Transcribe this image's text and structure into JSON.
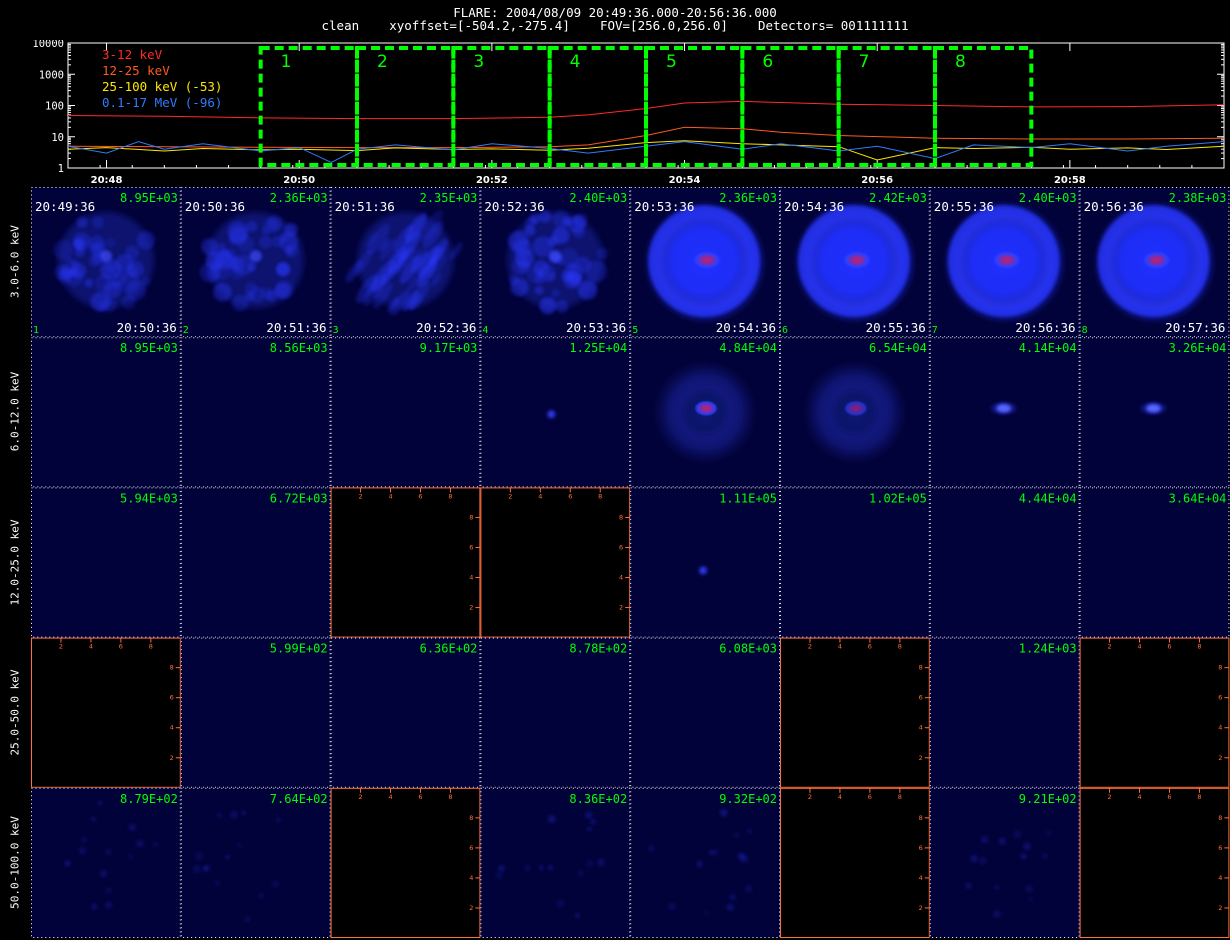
{
  "header": {
    "line1": "FLARE: 2004/08/09 20:49:36.000-20:56:36.000",
    "line2": "clean    xyoffset=[-504.2,-275.4]    FOV=[256.0,256.0]    Detectors= 001111111"
  },
  "colors": {
    "green": "#00ff00",
    "white": "#ffffff",
    "orange_axis": "#ff6f3c",
    "panel_bg": "#02023a"
  },
  "chart_data": [
    {
      "type": "line",
      "log_y": true,
      "ylim": [
        1,
        10000
      ],
      "yticks": [
        "10000",
        "1000",
        "100",
        "10",
        "1"
      ],
      "yticks_values": [
        10000,
        1000,
        100,
        10,
        1
      ],
      "xlim": [
        "20:47:36",
        "20:59:36"
      ],
      "xticks": [
        "20:48",
        "20:50",
        "20:52",
        "20:54",
        "20:56",
        "20:58"
      ],
      "legend": [
        {
          "label": "3-12 keV",
          "color": "#ff2a2a"
        },
        {
          "label": "12-25 keV",
          "color": "#ff5a1e"
        },
        {
          "label": "25-100 keV (-53)",
          "color": "#ffe600"
        },
        {
          "label": "0.1-17 MeV (-96)",
          "color": "#2f7bff"
        }
      ],
      "series": [
        {
          "name": "3-12 keV",
          "color": "#ff2a2a",
          "x": [
            "20:47:36",
            "20:48:36",
            "20:49:36",
            "20:50:36",
            "20:51:36",
            "20:52:36",
            "20:53:00",
            "20:53:36",
            "20:54:00",
            "20:54:36",
            "20:55:00",
            "20:55:36",
            "20:56:36",
            "20:57:36",
            "20:58:36",
            "20:59:36"
          ],
          "values": [
            48,
            45,
            40,
            38,
            38,
            42,
            50,
            80,
            120,
            135,
            125,
            110,
            100,
            90,
            92,
            105
          ]
        },
        {
          "name": "12-25 keV",
          "color": "#ff5a1e",
          "x": [
            "20:47:36",
            "20:48:36",
            "20:49:36",
            "20:50:36",
            "20:51:36",
            "20:52:36",
            "20:53:00",
            "20:53:36",
            "20:54:00",
            "20:54:36",
            "20:55:00",
            "20:55:36",
            "20:56:36",
            "20:57:36",
            "20:58:36",
            "20:59:36"
          ],
          "values": [
            5,
            4.8,
            4.6,
            4.5,
            4.5,
            4.8,
            5.5,
            11,
            20,
            18,
            14,
            11,
            9,
            8.5,
            8.5,
            9
          ]
        },
        {
          "name": "25-100 keV (-53)",
          "color": "#ffe600",
          "x": [
            "20:47:36",
            "20:48:00",
            "20:48:36",
            "20:49:00",
            "20:49:36",
            "20:50:00",
            "20:50:36",
            "20:51:00",
            "20:51:36",
            "20:52:00",
            "20:52:36",
            "20:53:00",
            "20:53:36",
            "20:54:00",
            "20:54:36",
            "20:55:00",
            "20:55:36",
            "20:56:00",
            "20:56:36",
            "20:57:00",
            "20:57:36",
            "20:58:00",
            "20:58:36",
            "20:59:00",
            "20:59:36"
          ],
          "values": [
            4,
            4.5,
            3.5,
            4.2,
            3.8,
            4.0,
            3.6,
            4.4,
            3.9,
            4.1,
            3.7,
            4.3,
            6.5,
            7.5,
            6,
            5.5,
            4.8,
            1.8,
            4.5,
            4.2,
            4.6,
            4.0,
            4.4,
            3.9,
            5
          ]
        },
        {
          "name": "0.1-17 MeV (-96)",
          "color": "#2f7bff",
          "x": [
            "20:47:36",
            "20:48:00",
            "20:48:20",
            "20:48:36",
            "20:49:00",
            "20:49:36",
            "20:50:00",
            "20:50:20",
            "20:50:36",
            "20:51:00",
            "20:51:36",
            "20:52:00",
            "20:52:36",
            "20:53:00",
            "20:53:36",
            "20:54:00",
            "20:54:36",
            "20:55:00",
            "20:55:36",
            "20:56:00",
            "20:56:36",
            "20:57:00",
            "20:57:36",
            "20:58:00",
            "20:58:36",
            "20:59:00",
            "20:59:36"
          ],
          "values": [
            5,
            3,
            7,
            4,
            6,
            3.5,
            4.5,
            1.5,
            4,
            5.5,
            3.8,
            6,
            4.2,
            3,
            5,
            7,
            4,
            6,
            3.5,
            5,
            2,
            5.5,
            4.5,
            6,
            3.5,
            5,
            7
          ]
        }
      ],
      "intervals": [
        {
          "label": "1",
          "start": "20:49:36",
          "end": "20:50:36"
        },
        {
          "label": "2",
          "start": "20:50:36",
          "end": "20:51:36"
        },
        {
          "label": "3",
          "start": "20:51:36",
          "end": "20:52:36"
        },
        {
          "label": "4",
          "start": "20:52:36",
          "end": "20:53:36"
        },
        {
          "label": "5",
          "start": "20:53:36",
          "end": "20:54:36"
        },
        {
          "label": "6",
          "start": "20:54:36",
          "end": "20:55:36"
        },
        {
          "label": "7",
          "start": "20:55:36",
          "end": "20:56:36"
        },
        {
          "label": "8",
          "start": "20:56:36",
          "end": "20:57:36"
        }
      ]
    },
    {
      "type": "heatmap",
      "energy_bands": [
        "3.0-6.0 keV",
        "6.0-12.0 keV",
        "12.0-25.0 keV",
        "25.0-50.0 keV",
        "50.0-100.0 keV"
      ],
      "start_times": [
        "20:49:36",
        "20:50:36",
        "20:51:36",
        "20:52:36",
        "20:53:36",
        "20:54:36",
        "20:55:36",
        "20:56:36"
      ],
      "end_times": [
        "20:50:36",
        "20:51:36",
        "20:52:36",
        "20:53:36",
        "20:54:36",
        "20:55:36",
        "20:56:36",
        "20:57:36"
      ],
      "interval_numbers": [
        "1",
        "2",
        "3",
        "4",
        "5",
        "6",
        "7",
        "8"
      ],
      "empty_panel_ticks": [
        "2",
        "4",
        "6",
        "8"
      ],
      "max_values": [
        [
          "8.95E+03",
          "2.36E+03",
          "2.35E+03",
          "2.40E+03",
          "2.36E+03",
          "2.42E+03",
          "2.40E+03",
          "2.38E+03"
        ],
        [
          "8.95E+03",
          "8.56E+03",
          "9.17E+03",
          "1.25E+04",
          "4.84E+04",
          "6.54E+04",
          "4.14E+04",
          "3.26E+04"
        ],
        [
          "5.94E+03",
          "6.72E+03",
          "",
          "",
          "1.11E+05",
          "1.02E+05",
          "4.44E+04",
          "3.64E+04"
        ],
        [
          "",
          "5.99E+02",
          "6.36E+02",
          "8.78E+02",
          "6.08E+03",
          "",
          "1.24E+03",
          ""
        ],
        [
          "8.79E+02",
          "7.64E+02",
          "",
          "8.36E+02",
          "9.32E+02",
          "",
          "9.21E+02",
          ""
        ]
      ],
      "empty_panels": [
        [
          false,
          false,
          false,
          false,
          false,
          false,
          false,
          false
        ],
        [
          false,
          false,
          false,
          false,
          false,
          false,
          false,
          false
        ],
        [
          false,
          false,
          true,
          true,
          false,
          false,
          false,
          false
        ],
        [
          true,
          false,
          false,
          false,
          false,
          true,
          false,
          true
        ],
        [
          false,
          false,
          true,
          false,
          false,
          true,
          false,
          true
        ]
      ],
      "source_intensity": [
        [
          0.28,
          0.3,
          0.33,
          0.45,
          1.0,
          1.0,
          0.95,
          0.9
        ],
        [
          0.0,
          0.0,
          0.0,
          0.08,
          0.85,
          0.8,
          0.45,
          0.4
        ],
        [
          0.0,
          0.0,
          0,
          0,
          0.12,
          0.0,
          0.0,
          0.0
        ],
        [
          0,
          0.0,
          0.0,
          0.0,
          0.0,
          0,
          0.0,
          0
        ],
        [
          0.12,
          0.12,
          0,
          0.1,
          0.1,
          0,
          0.08,
          0
        ]
      ],
      "source_morphology": [
        [
          "blobby",
          "blobby",
          "streaky",
          "blobby",
          "ring-core",
          "ring-core",
          "ring-core",
          "ring-core"
        ],
        [
          "none",
          "none",
          "none",
          "dot",
          "ring-core",
          "ring-core",
          "compact",
          "compact"
        ],
        [
          "none",
          "none",
          "none",
          "none",
          "dot",
          "none",
          "none",
          "none"
        ],
        [
          "none",
          "none",
          "none",
          "none",
          "none",
          "none",
          "none",
          "none"
        ],
        [
          "noise",
          "noise",
          "none",
          "noise",
          "noise",
          "none",
          "noise",
          "none"
        ]
      ]
    }
  ]
}
